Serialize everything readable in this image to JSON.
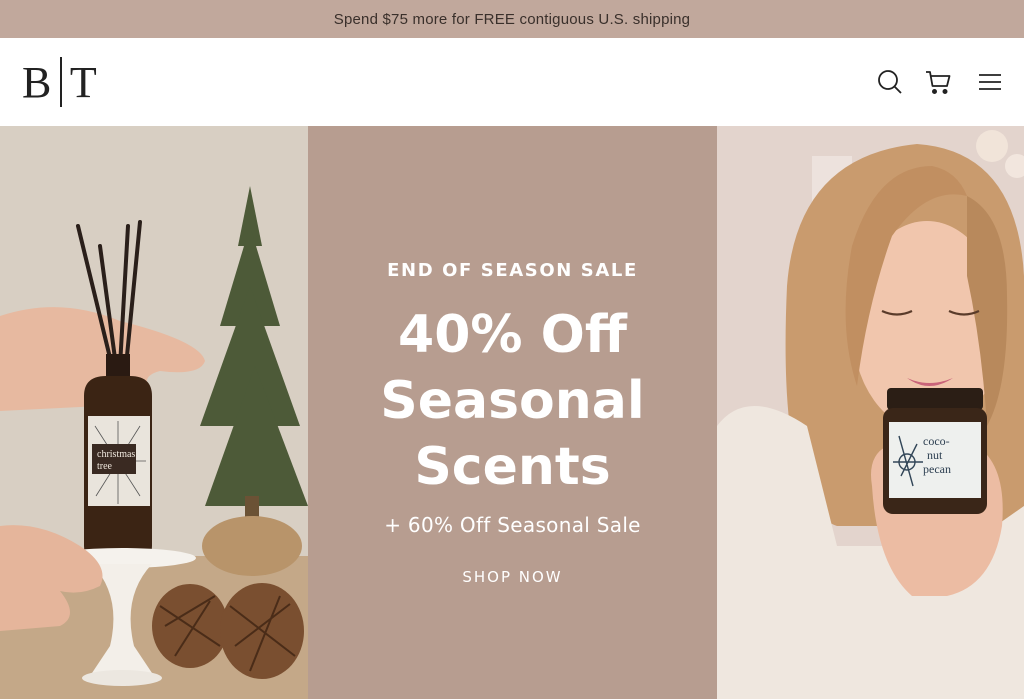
{
  "announcement": {
    "text": "Spend $75 more for FREE contiguous U.S. shipping"
  },
  "header": {
    "logo_left": "B",
    "logo_right": "T",
    "icons": [
      "search-icon",
      "cart-icon",
      "menu-icon"
    ]
  },
  "hero": {
    "eyebrow": "END OF SEASON SALE",
    "headline": "40% Off Seasonal Scents",
    "subline": "+ 60% Off Seasonal Sale",
    "cta_label": "SHOP NOW",
    "left_photo": {
      "product_label_line1": "christmas",
      "product_label_line2": "tree"
    },
    "right_photo": {
      "product_label_line1": "coco-",
      "product_label_line2": "nut",
      "product_label_line3": "pecan"
    }
  },
  "colors": {
    "announcement_bg": "#c1a89c",
    "panel_bg": "#b79d90",
    "text_dark": "#3a302b"
  }
}
